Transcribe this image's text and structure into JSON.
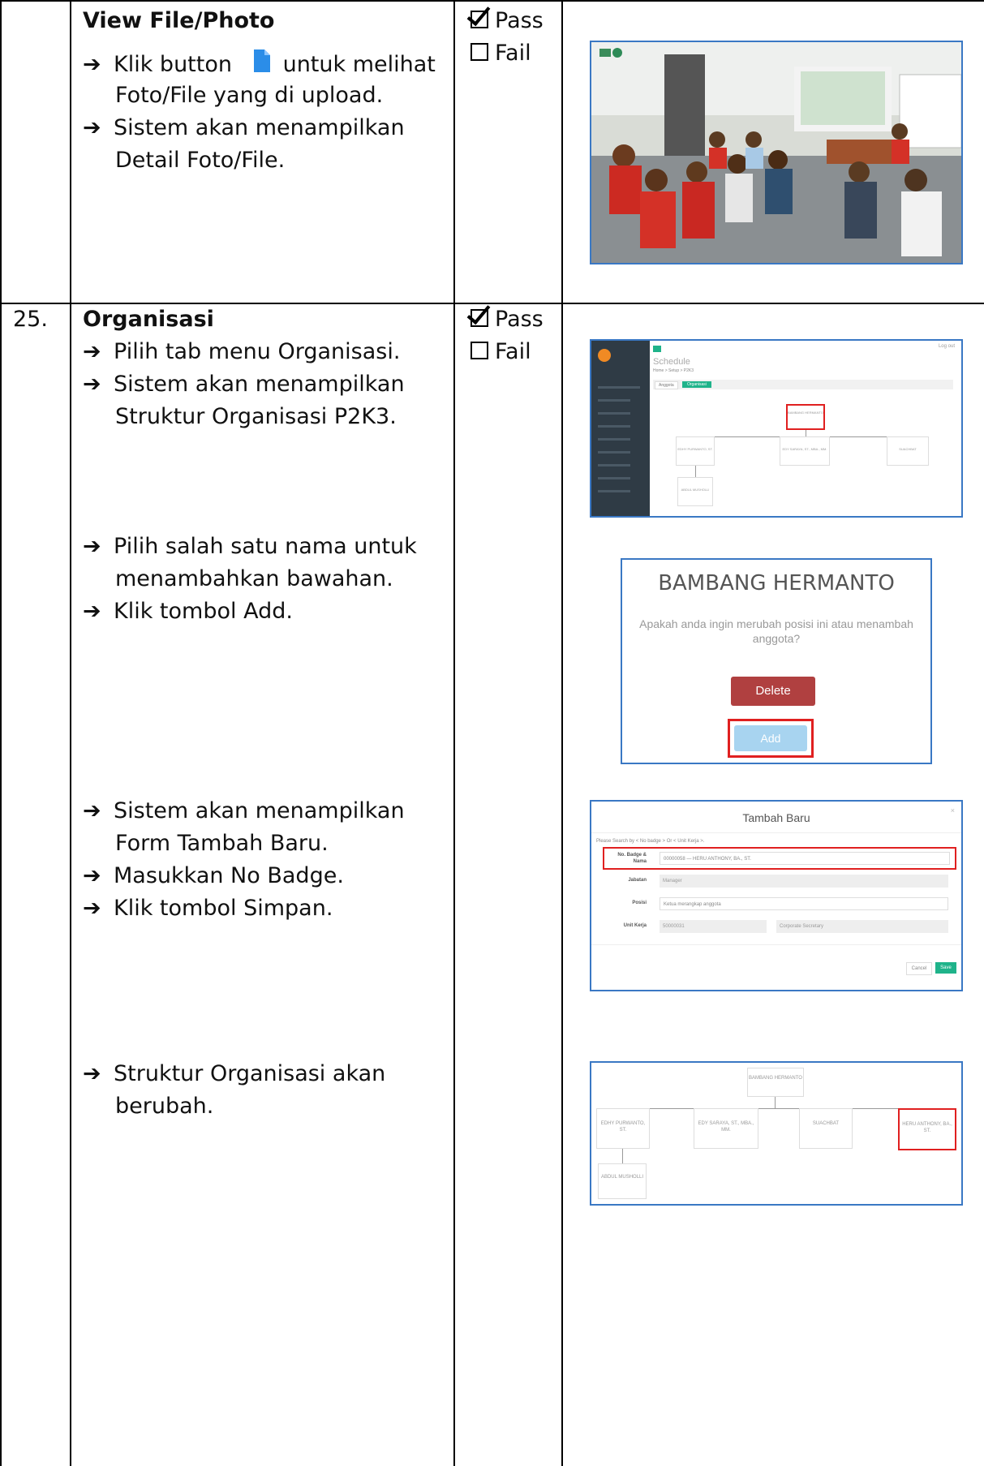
{
  "rows": [
    {
      "number": "",
      "title": "View File/Photo",
      "steps": [
        {
          "pre": "Klik button",
          "post": "untuk melihat",
          "line2": "Foto/File yang di upload."
        },
        {
          "line1": "Sistem akan menampilkan",
          "line2": "Detail Foto/File."
        }
      ],
      "status": {
        "pass": "Pass",
        "fail": "Fail"
      }
    },
    {
      "number": "25.",
      "title": "Organisasi",
      "steps": [
        {
          "line1": "Pilih tab menu Organisasi."
        },
        {
          "line1": "Sistem akan menampilkan",
          "line2": "Struktur Organisasi P2K3."
        },
        {
          "line1": "Pilih salah satu nama untuk",
          "line2": "menambahkan bawahan."
        },
        {
          "line1": "Klik tombol Add."
        },
        {
          "line1": "Sistem akan menampilkan",
          "line2": "Form Tambah Baru."
        },
        {
          "line1": "Masukkan No Badge."
        },
        {
          "line1": "Klik tombol Simpan."
        },
        {
          "line1": "Struktur Organisasi akan",
          "line2": "berubah."
        }
      ],
      "status": {
        "pass": "Pass",
        "fail": "Fail"
      }
    }
  ],
  "shot_org": {
    "page_title": "Schedule",
    "breadcrumb": "Home > Setup > P2K3",
    "tabs": [
      "Anggota",
      "Organisasi"
    ],
    "top_node": "BAMBANG HERMANTO",
    "children": [
      "EDHY PURWANTO, ST.",
      "EDY SARAYA, ST., MBA., MM.",
      "SUACHBAT"
    ],
    "sub_child": "ABDUL MUSHOLLI",
    "logout": "Log out"
  },
  "shot_modal": {
    "name": "BAMBANG HERMANTO",
    "question": "Apakah anda ingin merubah posisi ini atau menambah anggota?",
    "delete": "Delete",
    "add": "Add"
  },
  "shot_form": {
    "title": "Tambah Baru",
    "hint": "Please Search by < No badge > Or < Unit Kerja >.",
    "badge_label": "No. Badge & Nama",
    "badge_value": "00000058 — HERU ANTHONY, BA., ST.",
    "jabatan_label": "Jabatan",
    "jabatan_value": "Manager",
    "posisi_label": "Posisi",
    "posisi_value": "Ketua merangkap anggota",
    "unit_label": "Unit Kerja",
    "unit_code": "50000031",
    "unit_name": "Corporate Secretary",
    "cancel": "Cancel",
    "save": "Save"
  },
  "shot_result": {
    "top_node": "BAMBANG HERMANTO",
    "children": [
      "EDHY PURWANTO, ST.",
      "EDY SARAYA, ST., MBA., MM.",
      "SUACHBAT",
      "HERU ANTHONY, BA., ST."
    ],
    "sub_child": "ABDUL MUSHOLLI"
  }
}
